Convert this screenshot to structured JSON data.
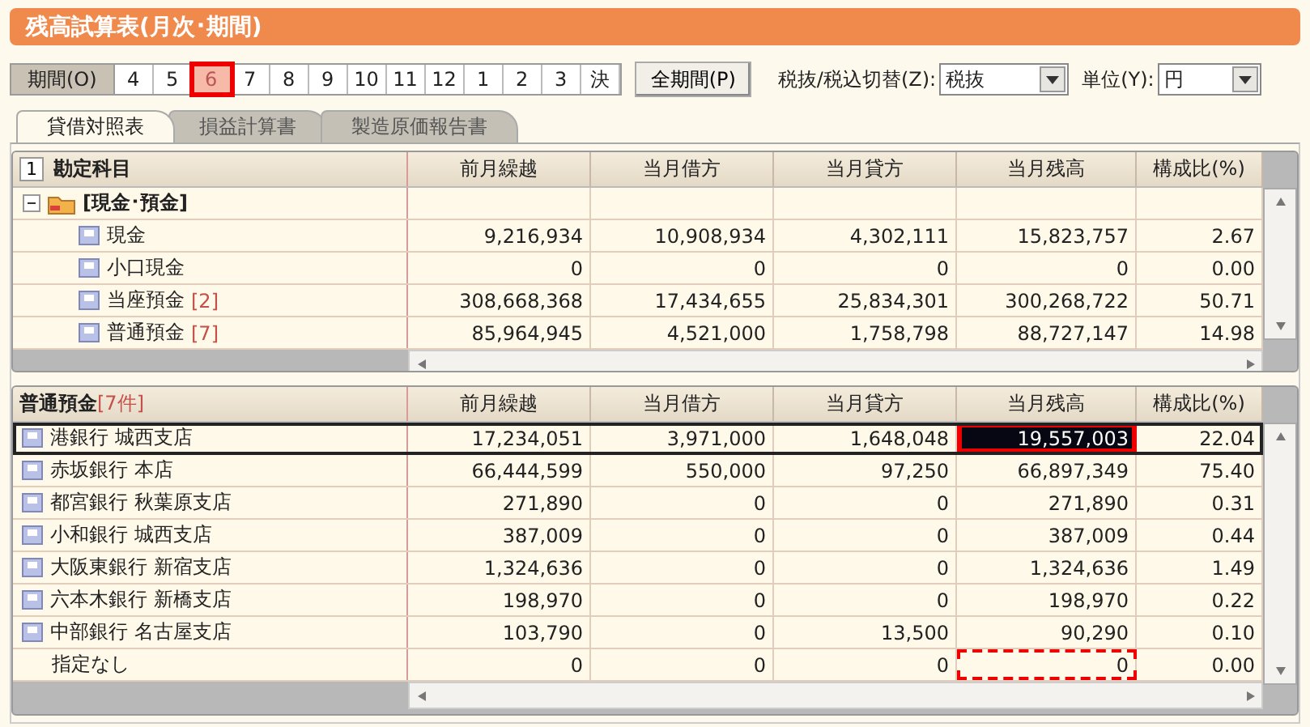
{
  "window": {
    "title": "残高試算表(月次･期間)"
  },
  "period_bar": {
    "label": "期間(O)",
    "items": [
      {
        "label": "4",
        "selected": false
      },
      {
        "label": "5",
        "selected": false
      },
      {
        "label": "6",
        "selected": true
      },
      {
        "label": "7",
        "selected": false
      },
      {
        "label": "8",
        "selected": false
      },
      {
        "label": "9",
        "selected": false
      },
      {
        "label": "10",
        "selected": false
      },
      {
        "label": "11",
        "selected": false
      },
      {
        "label": "12",
        "selected": false
      },
      {
        "label": "1",
        "selected": false
      },
      {
        "label": "2",
        "selected": false
      },
      {
        "label": "3",
        "selected": false
      },
      {
        "label": "決",
        "selected": false
      }
    ],
    "all_button": "全期間(P)",
    "tax_label": "税抜/税込切替(Z):",
    "tax_value": "税抜",
    "unit_label": "単位(Y):",
    "unit_value": "円"
  },
  "tabs": [
    {
      "label": "貸借対照表",
      "selected": true
    },
    {
      "label": "損益計算書",
      "selected": false
    },
    {
      "label": "製造原価報告書",
      "selected": false
    }
  ],
  "account_table": {
    "level_button": "1",
    "columns": [
      "勘定科目",
      "前月繰越",
      "当月借方",
      "当月貸方",
      "当月残高",
      "構成比(%)"
    ],
    "rows": [
      {
        "name": "[現金･預金]",
        "expanded": true,
        "children": [
          {
            "name": "現金",
            "values": [
              "9,216,934",
              "10,908,934",
              "4,302,111",
              "15,823,757",
              "2.67"
            ]
          },
          {
            "name": "小口現金",
            "values": [
              "0",
              "0",
              "0",
              "0",
              "0.00"
            ]
          },
          {
            "name": "当座預金",
            "count": "[2]",
            "values": [
              "308,668,368",
              "17,434,655",
              "25,834,301",
              "300,268,722",
              "50.71"
            ]
          },
          {
            "name": "普通預金",
            "count": "[7]",
            "values": [
              "85,964,945",
              "4,521,000",
              "1,758,798",
              "88,727,147",
              "14.98"
            ]
          }
        ]
      }
    ]
  },
  "detail_table": {
    "title": "普通預金",
    "count": "[7件]",
    "columns": [
      "前月繰越",
      "当月借方",
      "当月貸方",
      "当月残高",
      "構成比(%)"
    ],
    "rows": [
      {
        "name": "港銀行 城西支店",
        "kind": "account",
        "selected": true,
        "cells": [
          {
            "text": "17,234,051",
            "selected": false,
            "marked": false
          },
          {
            "text": "3,971,000",
            "selected": false,
            "marked": false
          },
          {
            "text": "1,648,048",
            "selected": false,
            "marked": false
          },
          {
            "text": "19,557,003",
            "selected": true,
            "marked": true
          },
          {
            "text": "22.04",
            "selected": false,
            "marked": false
          }
        ]
      },
      {
        "name": "赤坂銀行 本店",
        "kind": "account",
        "selected": false,
        "cells": [
          {
            "text": "66,444,599",
            "selected": false,
            "marked": false
          },
          {
            "text": "550,000",
            "selected": false,
            "marked": false
          },
          {
            "text": "97,250",
            "selected": false,
            "marked": false
          },
          {
            "text": "66,897,349",
            "selected": false,
            "marked": false
          },
          {
            "text": "75.40",
            "selected": false,
            "marked": false
          }
        ]
      },
      {
        "name": "都宮銀行 秋葉原支店",
        "kind": "account",
        "selected": false,
        "cells": [
          {
            "text": "271,890",
            "selected": false,
            "marked": false
          },
          {
            "text": "0",
            "selected": false,
            "marked": false
          },
          {
            "text": "0",
            "selected": false,
            "marked": false
          },
          {
            "text": "271,890",
            "selected": false,
            "marked": false
          },
          {
            "text": "0.31",
            "selected": false,
            "marked": false
          }
        ]
      },
      {
        "name": "小和銀行 城西支店",
        "kind": "account",
        "selected": false,
        "cells": [
          {
            "text": "387,009",
            "selected": false,
            "marked": false
          },
          {
            "text": "0",
            "selected": false,
            "marked": false
          },
          {
            "text": "0",
            "selected": false,
            "marked": false
          },
          {
            "text": "387,009",
            "selected": false,
            "marked": false
          },
          {
            "text": "0.44",
            "selected": false,
            "marked": false
          }
        ]
      },
      {
        "name": "大阪東銀行 新宿支店",
        "kind": "account",
        "selected": false,
        "cells": [
          {
            "text": "1,324,636",
            "selected": false,
            "marked": false
          },
          {
            "text": "0",
            "selected": false,
            "marked": false
          },
          {
            "text": "0",
            "selected": false,
            "marked": false
          },
          {
            "text": "1,324,636",
            "selected": false,
            "marked": false
          },
          {
            "text": "1.49",
            "selected": false,
            "marked": false
          }
        ]
      },
      {
        "name": "六本木銀行 新橋支店",
        "kind": "account",
        "selected": false,
        "cells": [
          {
            "text": "198,970",
            "selected": false,
            "marked": false
          },
          {
            "text": "0",
            "selected": false,
            "marked": false
          },
          {
            "text": "0",
            "selected": false,
            "marked": false
          },
          {
            "text": "198,970",
            "selected": false,
            "marked": false
          },
          {
            "text": "0.22",
            "selected": false,
            "marked": false
          }
        ]
      },
      {
        "name": "中部銀行 名古屋支店",
        "kind": "account",
        "selected": false,
        "cells": [
          {
            "text": "103,790",
            "selected": false,
            "marked": false
          },
          {
            "text": "0",
            "selected": false,
            "marked": false
          },
          {
            "text": "13,500",
            "selected": false,
            "marked": false
          },
          {
            "text": "90,290",
            "selected": false,
            "marked": false
          },
          {
            "text": "0.10",
            "selected": false,
            "marked": false
          }
        ]
      },
      {
        "name": "指定なし",
        "kind": "none",
        "selected": false,
        "cells": [
          {
            "text": "0",
            "selected": false,
            "marked": false
          },
          {
            "text": "0",
            "selected": false,
            "marked": false
          },
          {
            "text": "0",
            "selected": false,
            "marked": false
          },
          {
            "text": "0",
            "selected": false,
            "marked": true
          },
          {
            "text": "0.00",
            "selected": false,
            "marked": false
          }
        ]
      }
    ]
  }
}
